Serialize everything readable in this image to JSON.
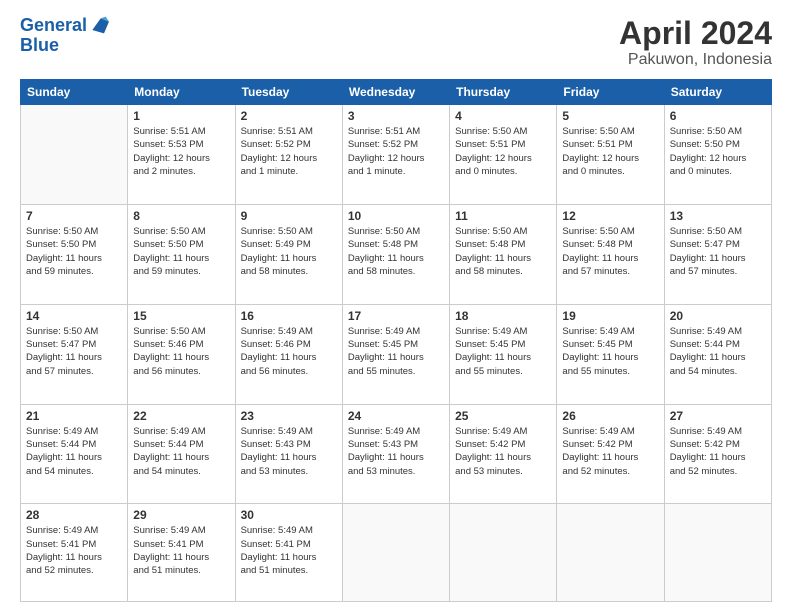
{
  "header": {
    "logo_line1": "General",
    "logo_line2": "Blue",
    "month": "April 2024",
    "location": "Pakuwon, Indonesia"
  },
  "columns": [
    "Sunday",
    "Monday",
    "Tuesday",
    "Wednesday",
    "Thursday",
    "Friday",
    "Saturday"
  ],
  "weeks": [
    [
      {
        "day": "",
        "info": ""
      },
      {
        "day": "1",
        "info": "Sunrise: 5:51 AM\nSunset: 5:53 PM\nDaylight: 12 hours\nand 2 minutes."
      },
      {
        "day": "2",
        "info": "Sunrise: 5:51 AM\nSunset: 5:52 PM\nDaylight: 12 hours\nand 1 minute."
      },
      {
        "day": "3",
        "info": "Sunrise: 5:51 AM\nSunset: 5:52 PM\nDaylight: 12 hours\nand 1 minute."
      },
      {
        "day": "4",
        "info": "Sunrise: 5:50 AM\nSunset: 5:51 PM\nDaylight: 12 hours\nand 0 minutes."
      },
      {
        "day": "5",
        "info": "Sunrise: 5:50 AM\nSunset: 5:51 PM\nDaylight: 12 hours\nand 0 minutes."
      },
      {
        "day": "6",
        "info": "Sunrise: 5:50 AM\nSunset: 5:50 PM\nDaylight: 12 hours\nand 0 minutes."
      }
    ],
    [
      {
        "day": "7",
        "info": "Sunrise: 5:50 AM\nSunset: 5:50 PM\nDaylight: 11 hours\nand 59 minutes."
      },
      {
        "day": "8",
        "info": "Sunrise: 5:50 AM\nSunset: 5:50 PM\nDaylight: 11 hours\nand 59 minutes."
      },
      {
        "day": "9",
        "info": "Sunrise: 5:50 AM\nSunset: 5:49 PM\nDaylight: 11 hours\nand 58 minutes."
      },
      {
        "day": "10",
        "info": "Sunrise: 5:50 AM\nSunset: 5:48 PM\nDaylight: 11 hours\nand 58 minutes."
      },
      {
        "day": "11",
        "info": "Sunrise: 5:50 AM\nSunset: 5:48 PM\nDaylight: 11 hours\nand 58 minutes."
      },
      {
        "day": "12",
        "info": "Sunrise: 5:50 AM\nSunset: 5:48 PM\nDaylight: 11 hours\nand 57 minutes."
      },
      {
        "day": "13",
        "info": "Sunrise: 5:50 AM\nSunset: 5:47 PM\nDaylight: 11 hours\nand 57 minutes."
      }
    ],
    [
      {
        "day": "14",
        "info": "Sunrise: 5:50 AM\nSunset: 5:47 PM\nDaylight: 11 hours\nand 57 minutes."
      },
      {
        "day": "15",
        "info": "Sunrise: 5:50 AM\nSunset: 5:46 PM\nDaylight: 11 hours\nand 56 minutes."
      },
      {
        "day": "16",
        "info": "Sunrise: 5:49 AM\nSunset: 5:46 PM\nDaylight: 11 hours\nand 56 minutes."
      },
      {
        "day": "17",
        "info": "Sunrise: 5:49 AM\nSunset: 5:45 PM\nDaylight: 11 hours\nand 55 minutes."
      },
      {
        "day": "18",
        "info": "Sunrise: 5:49 AM\nSunset: 5:45 PM\nDaylight: 11 hours\nand 55 minutes."
      },
      {
        "day": "19",
        "info": "Sunrise: 5:49 AM\nSunset: 5:45 PM\nDaylight: 11 hours\nand 55 minutes."
      },
      {
        "day": "20",
        "info": "Sunrise: 5:49 AM\nSunset: 5:44 PM\nDaylight: 11 hours\nand 54 minutes."
      }
    ],
    [
      {
        "day": "21",
        "info": "Sunrise: 5:49 AM\nSunset: 5:44 PM\nDaylight: 11 hours\nand 54 minutes."
      },
      {
        "day": "22",
        "info": "Sunrise: 5:49 AM\nSunset: 5:44 PM\nDaylight: 11 hours\nand 54 minutes."
      },
      {
        "day": "23",
        "info": "Sunrise: 5:49 AM\nSunset: 5:43 PM\nDaylight: 11 hours\nand 53 minutes."
      },
      {
        "day": "24",
        "info": "Sunrise: 5:49 AM\nSunset: 5:43 PM\nDaylight: 11 hours\nand 53 minutes."
      },
      {
        "day": "25",
        "info": "Sunrise: 5:49 AM\nSunset: 5:42 PM\nDaylight: 11 hours\nand 53 minutes."
      },
      {
        "day": "26",
        "info": "Sunrise: 5:49 AM\nSunset: 5:42 PM\nDaylight: 11 hours\nand 52 minutes."
      },
      {
        "day": "27",
        "info": "Sunrise: 5:49 AM\nSunset: 5:42 PM\nDaylight: 11 hours\nand 52 minutes."
      }
    ],
    [
      {
        "day": "28",
        "info": "Sunrise: 5:49 AM\nSunset: 5:41 PM\nDaylight: 11 hours\nand 52 minutes."
      },
      {
        "day": "29",
        "info": "Sunrise: 5:49 AM\nSunset: 5:41 PM\nDaylight: 11 hours\nand 51 minutes."
      },
      {
        "day": "30",
        "info": "Sunrise: 5:49 AM\nSunset: 5:41 PM\nDaylight: 11 hours\nand 51 minutes."
      },
      {
        "day": "",
        "info": ""
      },
      {
        "day": "",
        "info": ""
      },
      {
        "day": "",
        "info": ""
      },
      {
        "day": "",
        "info": ""
      }
    ]
  ]
}
